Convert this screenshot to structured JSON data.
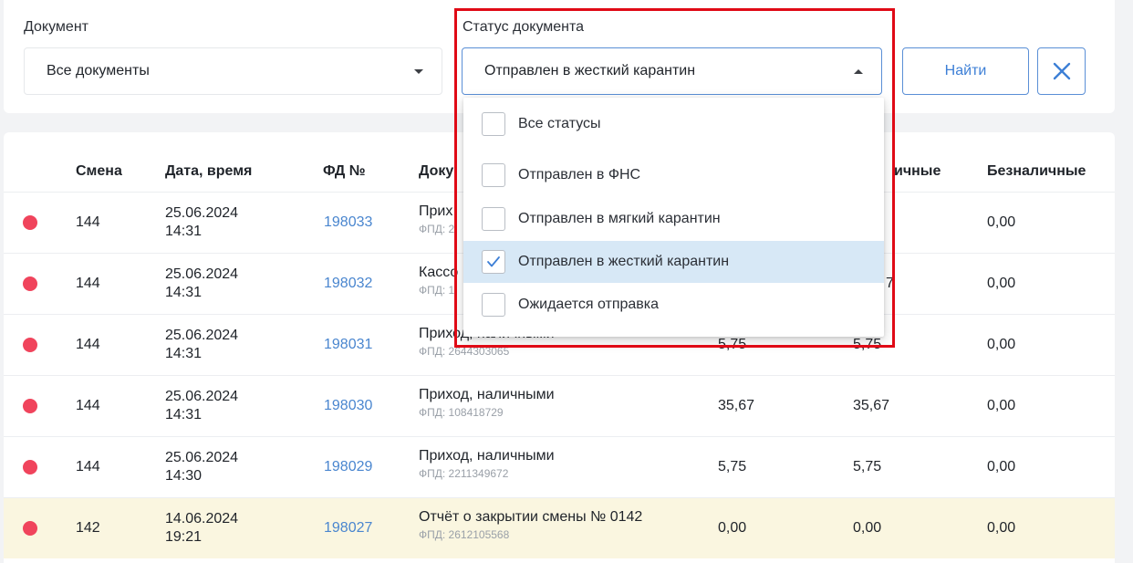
{
  "filters": {
    "document_label": "Документ",
    "document_value": "Все документы",
    "status_label": "Статус документа",
    "status_value": "Отправлен в жесткий карантин",
    "find_button": "Найти"
  },
  "dropdown": {
    "options": [
      {
        "label": "Все статусы",
        "checked": false
      },
      {
        "label": "Отправлен в ФНС",
        "checked": false
      },
      {
        "label": "Отправлен в мягкий карантин",
        "checked": false
      },
      {
        "label": "Отправлен в жесткий карантин",
        "checked": true
      },
      {
        "label": "Ожидается отправка",
        "checked": false
      }
    ]
  },
  "table": {
    "headers": {
      "shift": "Смена",
      "datetime": "Дата, время",
      "fd": "ФД №",
      "document": "Доку",
      "cash": "ичные",
      "noncash": "Безналичные"
    },
    "rows": [
      {
        "shift": "144",
        "date": "25.06.2024",
        "time": "14:31",
        "fd": "198033",
        "doc": "Прих",
        "fpd": "ФПД: 2",
        "amount": "",
        "cash": "",
        "noncash": "0,00"
      },
      {
        "shift": "144",
        "date": "25.06.2024",
        "time": "14:31",
        "fd": "198032",
        "doc": "Кассо",
        "fpd": "ФПД: 1",
        "amount": "",
        "cash": "7",
        "noncash": "0,00"
      },
      {
        "shift": "144",
        "date": "25.06.2024",
        "time": "14:31",
        "fd": "198031",
        "doc": "Приход, наличными",
        "fpd": "ФПД: 2644303065",
        "amount": "5,75",
        "cash": "5,75",
        "noncash": "0,00"
      },
      {
        "shift": "144",
        "date": "25.06.2024",
        "time": "14:31",
        "fd": "198030",
        "doc": "Приход, наличными",
        "fpd": "ФПД: 108418729",
        "amount": "35,67",
        "cash": "35,67",
        "noncash": "0,00"
      },
      {
        "shift": "144",
        "date": "25.06.2024",
        "time": "14:30",
        "fd": "198029",
        "doc": "Приход, наличными",
        "fpd": "ФПД: 2211349672",
        "amount": "5,75",
        "cash": "5,75",
        "noncash": "0,00"
      },
      {
        "shift": "142",
        "date": "14.06.2024",
        "time": "19:21",
        "fd": "198027",
        "doc": "Отчёт о закрытии смены № 0142",
        "fpd": "ФПД: 2612105568",
        "amount": "0,00",
        "cash": "0,00",
        "noncash": "0,00"
      }
    ]
  },
  "colors": {
    "status_dot": "#f0445c",
    "accent": "#3d7fd6",
    "highlight_row": "#faf6e0",
    "selected_option": "#d7e8f6",
    "annotation_frame": "#e00a16"
  },
  "icons": {
    "clear": "close-icon",
    "checkbox_checked": "check-icon",
    "caret": "caret-down-icon"
  }
}
